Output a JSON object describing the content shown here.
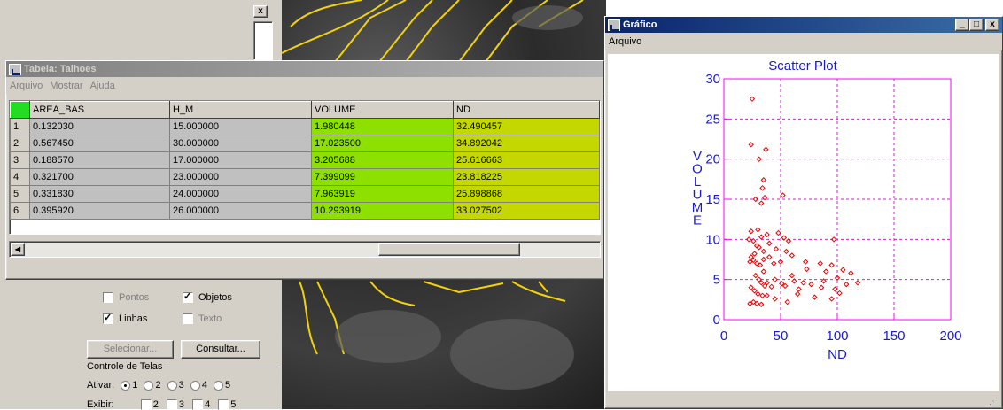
{
  "background": {
    "close_glyph": "x"
  },
  "table_window": {
    "title": "Tabela: Talhoes",
    "menu": [
      "Arquivo",
      "Mostrar",
      "Ajuda"
    ],
    "columns": [
      "AREA_BAS",
      "H_M",
      "VOLUME",
      "ND"
    ],
    "rows": [
      {
        "n": "1",
        "area": "0.132030",
        "hm": "15.000000",
        "vol": "1.980448",
        "nd": "32.490457"
      },
      {
        "n": "2",
        "area": "0.567450",
        "hm": "30.000000",
        "vol": "17.023500",
        "nd": "34.892042"
      },
      {
        "n": "3",
        "area": "0.188570",
        "hm": "17.000000",
        "vol": "3.205688",
        "nd": "25.616663"
      },
      {
        "n": "4",
        "area": "0.321700",
        "hm": "23.000000",
        "vol": "7.399099",
        "nd": "23.818225"
      },
      {
        "n": "5",
        "area": "0.331830",
        "hm": "24.000000",
        "vol": "7.963919",
        "nd": "25.898868"
      },
      {
        "n": "6",
        "area": "0.395920",
        "hm": "26.000000",
        "vol": "10.293919",
        "nd": "33.027502"
      }
    ],
    "colors": {
      "header_select": "#22dd22",
      "volume": "#8ee000",
      "nd": "#c4d800"
    }
  },
  "left_panel": {
    "checkboxes": {
      "pontos": "Pontos",
      "objetos": "Objetos",
      "linhas": "Linhas",
      "texto": "Texto"
    },
    "selecionar": "Selecionar...",
    "consultar": "Consultar...",
    "group_title": "Controle de Telas",
    "ativar_label": "Ativar:",
    "screens": [
      "1",
      "2",
      "3",
      "4",
      "5"
    ],
    "exibir_label": "Exibir:"
  },
  "chart_window": {
    "title": "Gráfico",
    "menu": [
      "Arquivo"
    ],
    "buttons": {
      "minimize": "_",
      "maximize": "□",
      "close": "x"
    }
  },
  "chart_data": {
    "type": "scatter",
    "title": "Scatter Plot",
    "xlabel": "ND",
    "ylabel": "VOLUME",
    "xlim": [
      0,
      200
    ],
    "ylim": [
      0,
      30
    ],
    "xticks": [
      0,
      50,
      100,
      150,
      200
    ],
    "yticks": [
      0,
      5,
      10,
      15,
      20,
      25,
      30
    ],
    "grid": true,
    "colors": {
      "title": "#1a1acc",
      "axes": "#ff00ff",
      "points": "#ee0000"
    },
    "points": [
      [
        25,
        27.5
      ],
      [
        24,
        21.8
      ],
      [
        37,
        21.2
      ],
      [
        31,
        20
      ],
      [
        35,
        17.4
      ],
      [
        34,
        16.4
      ],
      [
        36,
        15.2
      ],
      [
        28,
        15
      ],
      [
        33,
        14.5
      ],
      [
        52,
        15.5
      ],
      [
        24,
        11
      ],
      [
        30,
        11.2
      ],
      [
        33,
        10.3
      ],
      [
        38,
        10.6
      ],
      [
        48,
        10.8
      ],
      [
        22,
        10
      ],
      [
        26,
        9.8
      ],
      [
        29,
        9.2
      ],
      [
        31,
        9
      ],
      [
        35,
        8.5
      ],
      [
        27,
        8.2
      ],
      [
        24,
        7.8
      ],
      [
        26,
        7.4
      ],
      [
        23,
        7.2
      ],
      [
        29,
        7
      ],
      [
        32,
        6.8
      ],
      [
        35,
        7.5
      ],
      [
        40,
        7.8
      ],
      [
        44,
        7
      ],
      [
        50,
        7.2
      ],
      [
        55,
        8.5
      ],
      [
        60,
        8
      ],
      [
        72,
        7.2
      ],
      [
        85,
        7
      ],
      [
        97,
        10
      ],
      [
        95,
        6.8
      ],
      [
        90,
        6
      ],
      [
        105,
        6.2
      ],
      [
        112,
        5.8
      ],
      [
        118,
        4.6
      ],
      [
        28,
        5.5
      ],
      [
        31,
        5
      ],
      [
        33,
        4.6
      ],
      [
        36,
        4.2
      ],
      [
        38,
        4.6
      ],
      [
        42,
        4.1
      ],
      [
        45,
        5
      ],
      [
        51,
        4.5
      ],
      [
        54,
        4.2
      ],
      [
        62,
        4.8
      ],
      [
        70,
        4.6
      ],
      [
        77,
        4.4
      ],
      [
        86,
        4
      ],
      [
        98,
        3.8
      ],
      [
        108,
        4.4
      ],
      [
        24,
        4
      ],
      [
        27,
        3.6
      ],
      [
        30,
        3.2
      ],
      [
        34,
        3
      ],
      [
        38,
        3
      ],
      [
        45,
        2.6
      ],
      [
        56,
        2.2
      ],
      [
        65,
        3.2
      ],
      [
        80,
        2.8
      ],
      [
        95,
        2.6
      ],
      [
        102,
        3.3
      ],
      [
        23,
        2
      ],
      [
        26,
        2.2
      ],
      [
        29,
        2
      ],
      [
        33,
        1.9
      ],
      [
        35,
        6
      ],
      [
        40,
        9.5
      ],
      [
        46,
        8.8
      ],
      [
        57,
        9.8
      ],
      [
        53,
        10.2
      ],
      [
        60,
        5.5
      ],
      [
        73,
        6.3
      ],
      [
        66,
        3.8
      ],
      [
        88,
        4.8
      ],
      [
        100,
        5.2
      ]
    ]
  }
}
